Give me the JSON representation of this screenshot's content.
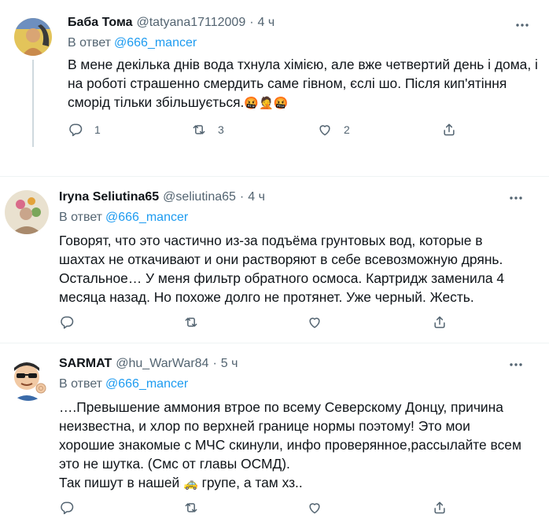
{
  "reply_prefix": "В ответ",
  "tweets": [
    {
      "name": "Баба Тома",
      "handle": "@tatyana17112009",
      "separator": "·",
      "time": "4 ч",
      "reply_to": "@666_mancer",
      "text": "В мене декілька днів вода тхнула хімією, але вже четвертий день і дома, і\nна роботі страшенно смердить саме гівном, єслі шо. Після кип'ятіння\nсморід тільки збільшується.",
      "emoji": "🤬🤦🤬",
      "reply_count": "1",
      "retweet_count": "3",
      "like_count": "2",
      "avatar_icon": "yellow-blue-avatar"
    },
    {
      "name": "Iryna Seliutina65",
      "handle": "@seliutina65",
      "separator": "·",
      "time": "4 ч",
      "reply_to": "@666_mancer",
      "text": "Говорят, что это частично из-за подъёма грунтовых вод, которые в\nшахтах не откачивают и они растворяют в себе всевозможную дрянь.\nОстальное… У меня фильтр обратного осмоса. Картридж заменила 4\nмесяца назад. Но похоже долго не протянет. Уже черный. Жесть.",
      "avatar_icon": "floral-avatar"
    },
    {
      "name": "SARMAT",
      "handle": "@hu_WarWar84",
      "separator": "·",
      "time": "5 ч",
      "reply_to": "@666_mancer",
      "text": "….Превышение аммония втрое по всему Северскому Донцу, причина\nнеизвестна, и хлор по верхней границе нормы поэтому! Это  мои\nхорошие знакомые с МЧС скинули, инфо проверянное,рассылайте всем\nэто не шутка. (Смс от главы ОСМД).",
      "text_last_a": "Так пишут в нашей ",
      "text_last_emoji": "🚕",
      "text_last_b": " групе, а там хз..",
      "avatar_icon": "sunglasses-ok-avatar"
    }
  ],
  "colors": {
    "text": "#0f1419",
    "secondary": "#536471",
    "link": "#1d9bf0",
    "divider": "#eff3f4",
    "thread_line": "#cfd9de"
  }
}
